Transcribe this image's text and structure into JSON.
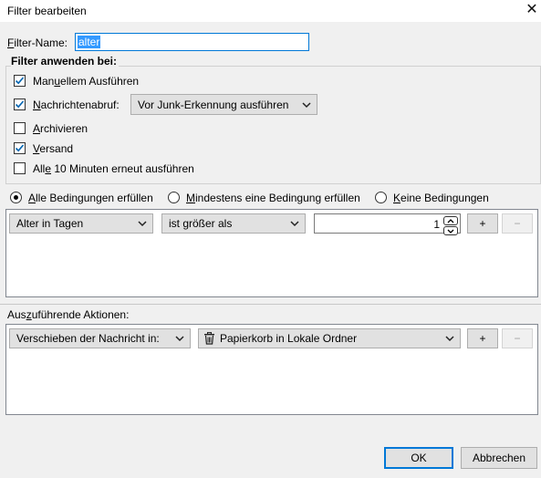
{
  "window": {
    "title": "Filter bearbeiten",
    "close_glyph": "✕"
  },
  "filter_name": {
    "label_u": "F",
    "label_rest": "ilter-Name:",
    "value": "alter"
  },
  "apply": {
    "heading": "Filter anwenden bei:",
    "items": [
      {
        "pre": "Man",
        "u": "u",
        "post": "ellem Ausführen",
        "checked": true
      },
      {
        "pre": "",
        "u": "N",
        "post": "achrichtenabruf:",
        "checked": true
      },
      {
        "pre": "",
        "u": "A",
        "post": "rchivieren",
        "checked": false
      },
      {
        "pre": "",
        "u": "V",
        "post": "ersand",
        "checked": true
      },
      {
        "pre": "All",
        "u": "e",
        "post": " 10 Minuten erneut ausführen",
        "checked": false
      }
    ],
    "junk_dropdown": "Vor Junk-Erkennung ausführen"
  },
  "match": {
    "options": [
      {
        "u": "A",
        "post": "lle Bedingungen erfüllen",
        "selected": true
      },
      {
        "u": "M",
        "post": "indestens eine Bedingung erfüllen",
        "selected": false
      },
      {
        "u": "K",
        "post": "eine Bedingungen",
        "selected": false
      }
    ]
  },
  "condition": {
    "field": "Alter in Tagen",
    "operator": "ist größer als",
    "value": "1",
    "add": "+",
    "remove": "−"
  },
  "actions": {
    "label_pre": "Aus",
    "label_u": "z",
    "label_post": "uführende Aktionen:",
    "action": "Verschieben der Nachricht in:",
    "target": "Papierkorb in Lokale Ordner",
    "target_icon": "trash-icon",
    "add": "+",
    "remove": "−"
  },
  "footer": {
    "ok": "OK",
    "cancel": "Abbrechen"
  },
  "colors": {
    "accent": "#0078d7",
    "selection": "#3399ff"
  }
}
